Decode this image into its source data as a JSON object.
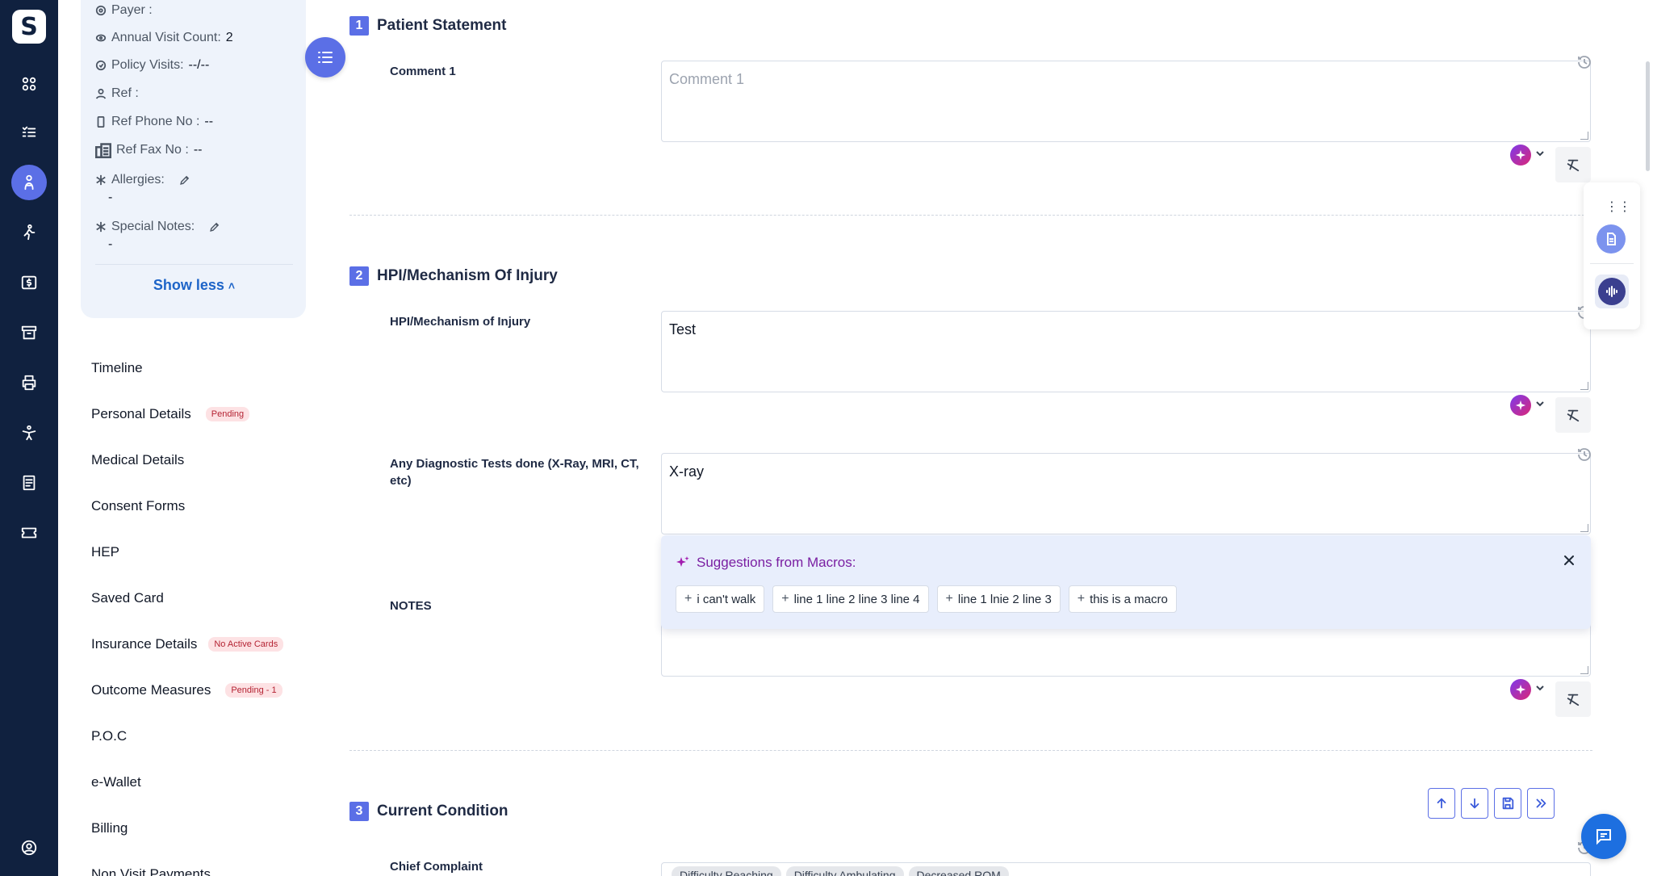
{
  "rail": {
    "logo": "S",
    "icons": [
      "grid-icon",
      "checklist-icon",
      "patient-care-icon",
      "walking-person-icon",
      "dollar-card-icon",
      "archive-icon",
      "printer-icon",
      "exercise-icon",
      "document-icon",
      "ticket-icon",
      "user-circle-icon"
    ]
  },
  "info": {
    "payer_label": "Payer :",
    "annual_label": "Annual Visit Count:",
    "annual_value": "2",
    "policy_label": "Policy Visits:",
    "policy_value": "--/--",
    "ref_label": "Ref :",
    "ref_phone_label": "Ref Phone No :",
    "ref_phone_value": "--",
    "ref_fax_label": "Ref Fax No :",
    "ref_fax_value": "--",
    "allergies_label": "Allergies:",
    "allergies_value": "-",
    "special_label": "Special Notes:",
    "special_value": "-",
    "show_less": "Show less"
  },
  "nav": [
    {
      "label": "Timeline",
      "badge": ""
    },
    {
      "label": "Personal Details",
      "badge": "Pending"
    },
    {
      "label": "Medical Details",
      "badge": ""
    },
    {
      "label": "Consent Forms",
      "badge": ""
    },
    {
      "label": "HEP",
      "badge": ""
    },
    {
      "label": "Saved Card",
      "badge": ""
    },
    {
      "label": "Insurance Details",
      "badge": "No Active Cards"
    },
    {
      "label": "Outcome Measures",
      "badge": "Pending - 1"
    },
    {
      "label": "P.O.C",
      "badge": ""
    },
    {
      "label": "e-Wallet",
      "badge": ""
    },
    {
      "label": "Billing",
      "badge": ""
    },
    {
      "label": "Non Visit Payments",
      "badge": ""
    }
  ],
  "sections": [
    {
      "num": "1",
      "title": "Patient Statement"
    },
    {
      "num": "2",
      "title": "HPI/Mechanism Of Injury"
    },
    {
      "num": "3",
      "title": "Current Condition"
    }
  ],
  "fields": {
    "comment1": {
      "label": "Comment 1",
      "placeholder": "Comment 1",
      "value": ""
    },
    "hpi": {
      "label": "HPI/Mechanism of Injury",
      "value": "Test"
    },
    "diag": {
      "label": "Any Diagnostic Tests done (X-Ray, MRI, CT, etc)",
      "value": "X-ray"
    },
    "notes": {
      "label": "NOTES",
      "value": ""
    },
    "chief": {
      "label": "Chief Complaint",
      "tags": [
        "Difficulty Reaching",
        "Difficulty Ambulating",
        "Decreased ROM"
      ]
    }
  },
  "macros": {
    "title": "Suggestions from Macros:",
    "chips": [
      "i can't walk",
      "line 1 line 2 line 3 line 4",
      "line 1 lnie 2 line 3",
      "this is a macro"
    ]
  },
  "colors": {
    "rail": "#10213f",
    "accent": "#5b6fe6",
    "link": "#1d64c8"
  }
}
